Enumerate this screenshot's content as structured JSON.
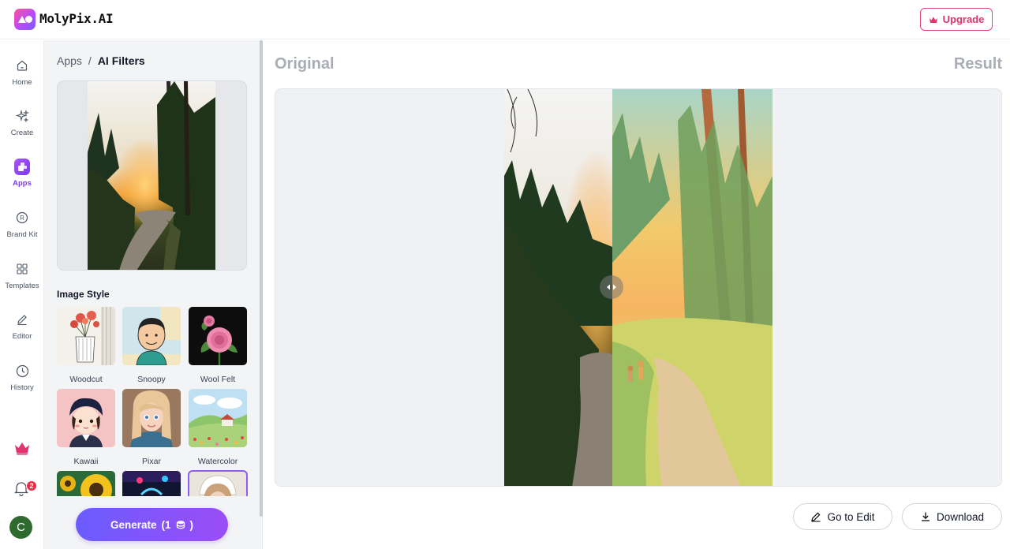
{
  "app": {
    "brand_name": "MolyPix.AI",
    "upgrade_label": "Upgrade",
    "accent_color": "#7c3aed",
    "upgrade_color": "#e2336f"
  },
  "rail": {
    "items": [
      {
        "label": "Home",
        "icon": "home-icon"
      },
      {
        "label": "Create",
        "icon": "sparkle-icon"
      },
      {
        "label": "Apps",
        "icon": "apps-icon",
        "active": true
      },
      {
        "label": "Brand Kit",
        "icon": "registered-icon"
      },
      {
        "label": "Templates",
        "icon": "grid-icon"
      },
      {
        "label": "Editor",
        "icon": "pencil-icon"
      },
      {
        "label": "History",
        "icon": "clock-icon"
      }
    ],
    "notification_count": "2",
    "avatar_initial": "C"
  },
  "panel": {
    "breadcrumb": {
      "root": "Apps",
      "separator": "/",
      "current": "AI Filters"
    },
    "section_title": "Image Style",
    "styles": [
      {
        "name": "Woodcut"
      },
      {
        "name": "Snoopy"
      },
      {
        "name": "Wool Felt"
      },
      {
        "name": "Kawaii"
      },
      {
        "name": "Pixar"
      },
      {
        "name": "Watercolor"
      },
      {
        "name": ""
      },
      {
        "name": ""
      },
      {
        "name": "",
        "selected": true
      }
    ],
    "generate_label": "Generate",
    "generate_cost": "(1",
    "generate_cost_close": ")"
  },
  "main": {
    "original_label": "Original",
    "result_label": "Result",
    "go_to_edit_label": "Go to Edit",
    "download_label": "Download"
  }
}
